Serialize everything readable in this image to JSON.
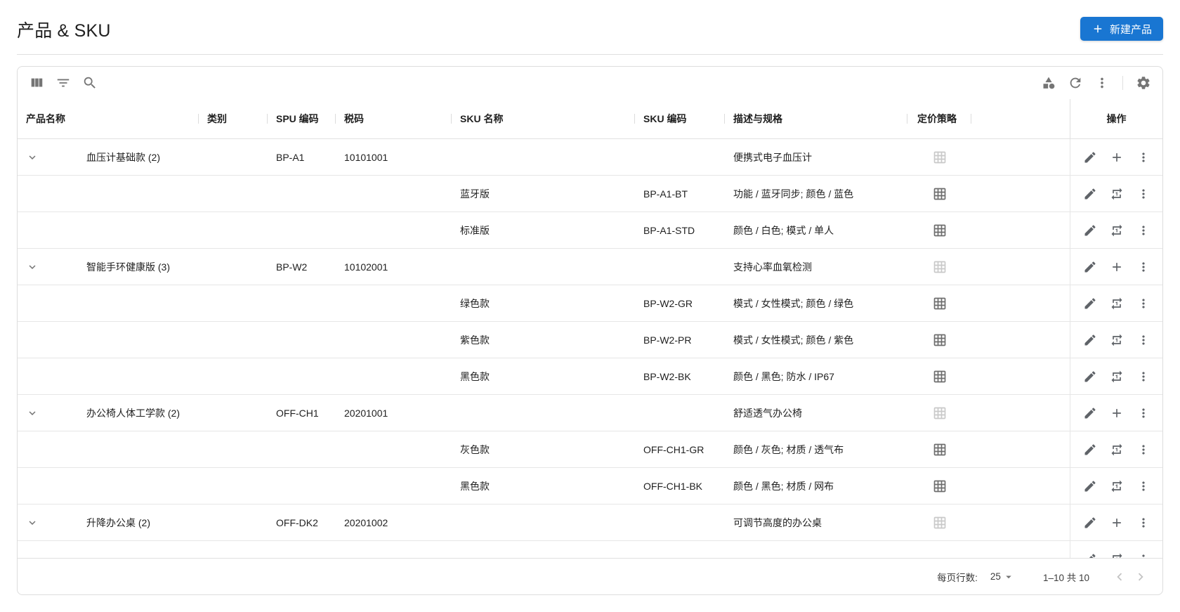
{
  "colors": {
    "accent": "#1976d2",
    "toolbar_icon": "#757575",
    "action_icon": "#5f6368",
    "disabled_icon": "#c9c9c9",
    "pagination_chevron": "#c4c4c4",
    "border": "#e0e0e0"
  },
  "page": {
    "title": "产品 & SKU"
  },
  "header": {
    "new_product_button": "新建产品",
    "plus_icon": "plus"
  },
  "toolbar": {
    "left_icons": [
      "view-columns",
      "filter",
      "search"
    ],
    "right_icons": [
      "shapes",
      "refresh",
      "more-vert",
      "settings"
    ]
  },
  "table": {
    "columns": [
      "产品名称",
      "类别",
      "SPU 编码",
      "税码",
      "SKU 名称",
      "SKU 编码",
      "描述与规格",
      "定价策略",
      "",
      "操作"
    ],
    "pricing_icon": "grid-on",
    "product_action_icons": [
      "edit",
      "add",
      "more-vert"
    ],
    "sku_action_icons": [
      "edit",
      "repeat-one",
      "more-vert"
    ],
    "rows": [
      {
        "type": "product",
        "name": "血压计基础款 (2)",
        "spu_code": "BP-A1",
        "tax_code": "10101001",
        "description": "便携式电子血压计"
      },
      {
        "type": "sku",
        "sku_name": "蓝牙版",
        "sku_code": "BP-A1-BT",
        "description": "功能 / 蓝牙同步; 颜色 / 蓝色"
      },
      {
        "type": "sku",
        "sku_name": "标准版",
        "sku_code": "BP-A1-STD",
        "description": "颜色 / 白色; 模式 / 单人"
      },
      {
        "type": "product",
        "name": "智能手环健康版 (3)",
        "spu_code": "BP-W2",
        "tax_code": "10102001",
        "description": "支持心率血氧检测"
      },
      {
        "type": "sku",
        "sku_name": "绿色款",
        "sku_code": "BP-W2-GR",
        "description": "模式 / 女性模式; 颜色 / 绿色"
      },
      {
        "type": "sku",
        "sku_name": "紫色款",
        "sku_code": "BP-W2-PR",
        "description": "模式 / 女性模式; 颜色 / 紫色"
      },
      {
        "type": "sku",
        "sku_name": "黑色款",
        "sku_code": "BP-W2-BK",
        "description": "颜色 / 黑色; 防水 / IP67"
      },
      {
        "type": "product",
        "name": "办公椅人体工学款 (2)",
        "spu_code": "OFF-CH1",
        "tax_code": "20201001",
        "description": "舒适透气办公椅"
      },
      {
        "type": "sku",
        "sku_name": "灰色款",
        "sku_code": "OFF-CH1-GR",
        "description": "颜色 / 灰色; 材质 / 透气布"
      },
      {
        "type": "sku",
        "sku_name": "黑色款",
        "sku_code": "OFF-CH1-BK",
        "description": "颜色 / 黑色; 材质 / 网布"
      },
      {
        "type": "product",
        "name": "升降办公桌 (2)",
        "spu_code": "OFF-DK2",
        "tax_code": "20201002",
        "description": "可调节高度的办公桌"
      },
      {
        "type": "sku",
        "sku_name": "",
        "sku_code": "",
        "description": "",
        "partial": true
      }
    ]
  },
  "pagination": {
    "rows_per_page_label": "每页行数:",
    "rows_per_page": "25",
    "range": "1–10 共 10"
  }
}
